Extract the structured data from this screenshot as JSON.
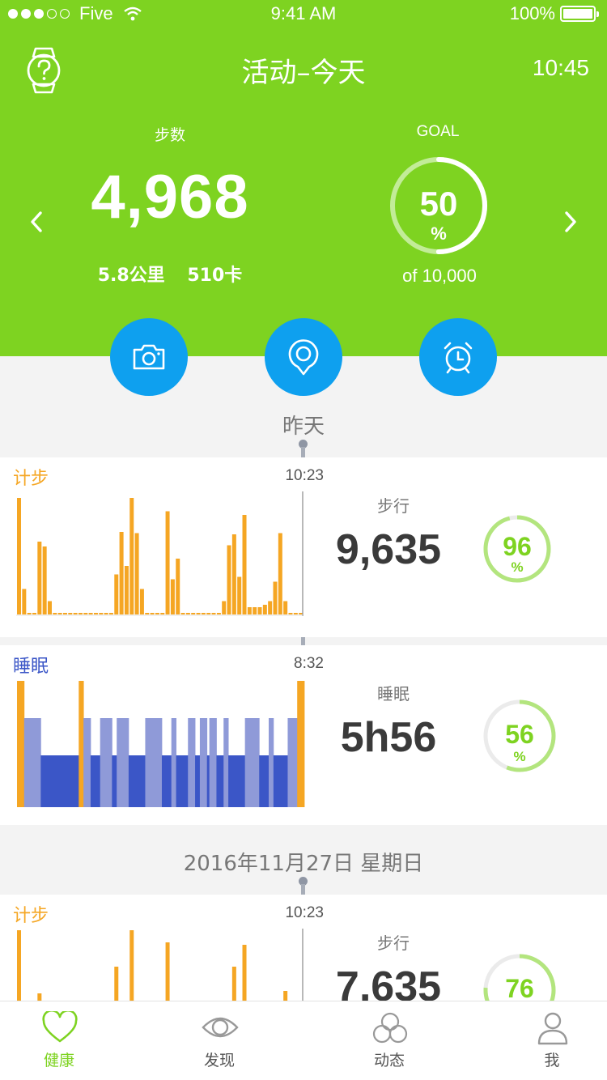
{
  "status_bar": {
    "carrier": "Five",
    "time": "9:41 AM",
    "battery": "100%"
  },
  "header": {
    "title": "活动–今天",
    "clock": "10:45",
    "steps_label": "步数",
    "steps_value": "4,968",
    "distance": "5.8公里",
    "calories": "510卡",
    "goal_label": "GOAL",
    "goal_percent": "50",
    "goal_percent_unit": "%",
    "goal_fraction": 0.5,
    "goal_of": "of 10,000"
  },
  "colors": {
    "brand_green": "#7ed321",
    "action_blue": "#0ea0ef",
    "steps_orange": "#f5a623",
    "sleep_deep": "#3b56c7",
    "sleep_light": "#8f9ad8"
  },
  "icons": {
    "help": "watch-help-icon",
    "prev": "chevron-left-icon",
    "next": "chevron-right-icon",
    "camera": "camera-icon",
    "location": "location-pin-icon",
    "alarm": "alarm-clock-icon"
  },
  "sections": [
    {
      "date_label": "昨天",
      "cards": [
        {
          "type": "steps",
          "title": "计步",
          "time": "10:23",
          "metric_label": "步行",
          "metric_value": "9,635",
          "percent": "96",
          "percent_unit": "%",
          "fraction": 0.96
        },
        {
          "type": "sleep",
          "title": "睡眠",
          "time": "8:32",
          "metric_label": "睡眠",
          "metric_value": "5h56",
          "percent": "56",
          "percent_unit": "%",
          "fraction": 0.56
        }
      ]
    },
    {
      "date_label": "2016年11月27日  星期日",
      "cards": [
        {
          "type": "steps",
          "title": "计步",
          "time": "10:23",
          "metric_label": "步行",
          "metric_value": "7,635",
          "percent": "76",
          "percent_unit": "%",
          "fraction": 0.76
        }
      ]
    }
  ],
  "charts": {
    "steps_yesterday": [
      0.96,
      0.21,
      0.01,
      0.01,
      0.6,
      0.56,
      0.11,
      0.01,
      0.01,
      0.01,
      0.01,
      0.01,
      0.01,
      0.01,
      0.01,
      0.01,
      0.01,
      0.01,
      0.01,
      0.33,
      0.68,
      0.4,
      0.96,
      0.67,
      0.21,
      0.01,
      0.01,
      0.01,
      0.01,
      0.85,
      0.29,
      0.46,
      0.01,
      0.01,
      0.01,
      0.01,
      0.01,
      0.01,
      0.01,
      0.01,
      0.11,
      0.57,
      0.66,
      0.31,
      0.82,
      0.06,
      0.06,
      0.06,
      0.08,
      0.11,
      0.27,
      0.67,
      0.11,
      0.01,
      0.01,
      0.01
    ],
    "sleep_yesterday": [
      {
        "d": 3,
        "s": "awake"
      },
      {
        "d": 7,
        "s": "light"
      },
      {
        "d": 16,
        "s": "deep"
      },
      {
        "d": 2,
        "s": "awake"
      },
      {
        "d": 3,
        "s": "light"
      },
      {
        "d": 4,
        "s": "deep"
      },
      {
        "d": 5,
        "s": "light"
      },
      {
        "d": 2,
        "s": "deep"
      },
      {
        "d": 5,
        "s": "light"
      },
      {
        "d": 7,
        "s": "deep"
      },
      {
        "d": 7,
        "s": "light"
      },
      {
        "d": 4,
        "s": "deep"
      },
      {
        "d": 2,
        "s": "light"
      },
      {
        "d": 5,
        "s": "deep"
      },
      {
        "d": 3,
        "s": "light"
      },
      {
        "d": 2,
        "s": "deep"
      },
      {
        "d": 3,
        "s": "light"
      },
      {
        "d": 1,
        "s": "deep"
      },
      {
        "d": 3,
        "s": "light"
      },
      {
        "d": 3,
        "s": "deep"
      },
      {
        "d": 2,
        "s": "light"
      },
      {
        "d": 7,
        "s": "deep"
      },
      {
        "d": 6,
        "s": "light"
      },
      {
        "d": 4,
        "s": "deep"
      },
      {
        "d": 2,
        "s": "light"
      },
      {
        "d": 6,
        "s": "deep"
      },
      {
        "d": 4,
        "s": "light"
      },
      {
        "d": 3,
        "s": "awake"
      }
    ],
    "steps_nov27": [
      1.0,
      0,
      0,
      0,
      0.48,
      0,
      0,
      0,
      0,
      0,
      0,
      0,
      0,
      0,
      0,
      0,
      0,
      0,
      0,
      0.7,
      0,
      0,
      1.0,
      0,
      0,
      0,
      0,
      0,
      0,
      0.9,
      0,
      0,
      0.06,
      0,
      0,
      0,
      0,
      0,
      0,
      0,
      0,
      0,
      0.7,
      0,
      0.88,
      0,
      0,
      0,
      0,
      0,
      0,
      0,
      0.5,
      0,
      0,
      0
    ]
  },
  "tabbar": [
    {
      "label": "健康",
      "icon": "heart-icon",
      "active": true
    },
    {
      "label": "发现",
      "icon": "eye-icon",
      "active": false
    },
    {
      "label": "动态",
      "icon": "clover-icon",
      "active": false
    },
    {
      "label": "我",
      "icon": "person-icon",
      "active": false
    }
  ]
}
